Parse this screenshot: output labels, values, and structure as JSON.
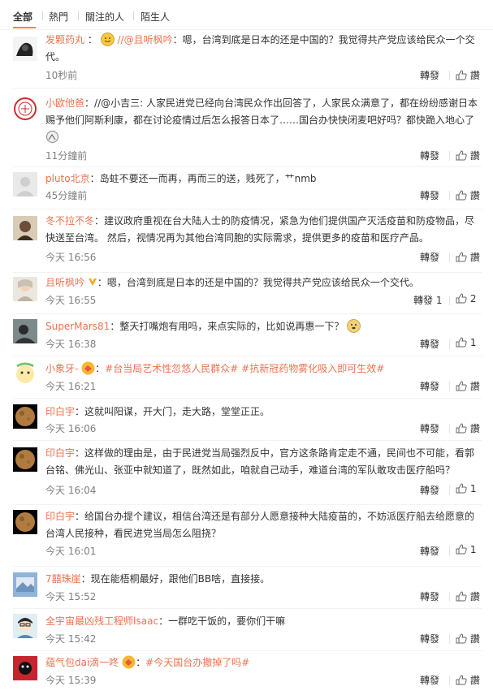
{
  "tabs": [
    "全部",
    "熱門",
    "關注的人",
    "陌生人"
  ],
  "actions": {
    "repost": "轉發",
    "reply_icon": "reply-icon",
    "like_icon": "thumbs-up-icon"
  },
  "comments": [
    {
      "user": "发颗药丸",
      "mention": "//@且听枫吟",
      "text": "嗯，台湾到底是日本的还是中国的？我觉得共产党应该给民众一个交代。",
      "time": "10秒前",
      "repost_count": "",
      "like_count": "",
      "reply_label": "讚"
    },
    {
      "user": "小欧他爸",
      "text": "//@小吉三: 人家民进党已经向台湾民众作出回答了，人家民众满意了，都在纷纷感谢日本赐予他们阿斯利康，都在讨论疫情过后怎么报答日本了……国台办快快闭麦吧好吗？都快跪入地心了",
      "time": "11分鐘前",
      "repost_count": "",
      "like_count": "",
      "reply_label": "讚"
    },
    {
      "user": "pluto北京",
      "text": "岛蛀不要还一而再，再而三的送，贱死了，艹nmb",
      "time": "45分鐘前",
      "repost_count": "",
      "like_count": "",
      "reply_label": "讚"
    },
    {
      "user": "冬不拉不冬",
      "text": "建议政府重视在台大陆人士的防疫情况，紧急为他们提供国产灭活疫苗和防疫物品，尽快送至台湾。 然后，视情况再为其他台湾同胞的实际需求，提供更多的疫苗和医疗产品。",
      "time": "今天 16:56",
      "repost_count": "",
      "like_count": "",
      "reply_label": "讚"
    },
    {
      "user": "且听枫吟",
      "text": "嗯，台湾到底是日本的还是中国的？我觉得共产党应该给民众一个交代。",
      "time": "今天 16:55",
      "repost_count": "1",
      "like_count": "2",
      "reply_label": ""
    },
    {
      "user": "SuperMars81",
      "text": "整天打嘴炮有用吗，来点实际的，比如说再惠一下？",
      "time": "今天 16:38",
      "repost_count": "",
      "like_count": "1",
      "reply_label": ""
    },
    {
      "user": "小象牙-",
      "topics": [
        "#台当局艺术性忽悠人民群众#",
        "#抗新冠药物雾化吸入即可生效#"
      ],
      "time": "今天 16:21",
      "repost_count": "",
      "like_count": "",
      "reply_label": "讚"
    },
    {
      "user": "印白宇",
      "text": "这就叫阳谋，开大门，走大路，堂堂正正。",
      "time": "今天 16:06",
      "repost_count": "",
      "like_count": "",
      "reply_label": "讚"
    },
    {
      "user": "印白宇",
      "text": "这样做的理由是，由于民进党当局强烈反中，官方这条路肯定走不通，民间也不可能，看郭台铭、佛光山、张亚中就知道了，既然如此，咱就自己动手，难道台湾的军队敢攻击医疗船吗？",
      "time": "今天 16:04",
      "repost_count": "",
      "like_count": "1",
      "reply_label": ""
    },
    {
      "user": "印白宇",
      "text": "给国台办提个建议，相信台湾还是有部分人愿意接种大陆疫苗的，不妨派医疗船去给愿意的台湾人民接种，看民进党当局怎么阻挠？",
      "time": "今天 16:01",
      "repost_count": "",
      "like_count": "1",
      "reply_label": ""
    },
    {
      "user": "7囍珠崖",
      "text": "现在能梧桐最好，跟他们BB啥，直接接。",
      "time": "今天 15:52",
      "repost_count": "",
      "like_count": "",
      "reply_label": "讚"
    },
    {
      "user": "全宇宙最凶残工程师Isaac",
      "text": "一群吃干饭的，要你们干嘛",
      "time": "今天 15:42",
      "repost_count": "",
      "like_count": "",
      "reply_label": "讚"
    },
    {
      "user": "蕴气包dai滴一咚",
      "topics": [
        "#今天国台办撤掉了吗#"
      ],
      "time": "今天 15:39",
      "repost_count": "",
      "like_count": "",
      "reply_label": "讚"
    }
  ],
  "colors": {
    "accent": "#eb7350",
    "tab_underline": "#ff8140",
    "meta": "#808080"
  }
}
